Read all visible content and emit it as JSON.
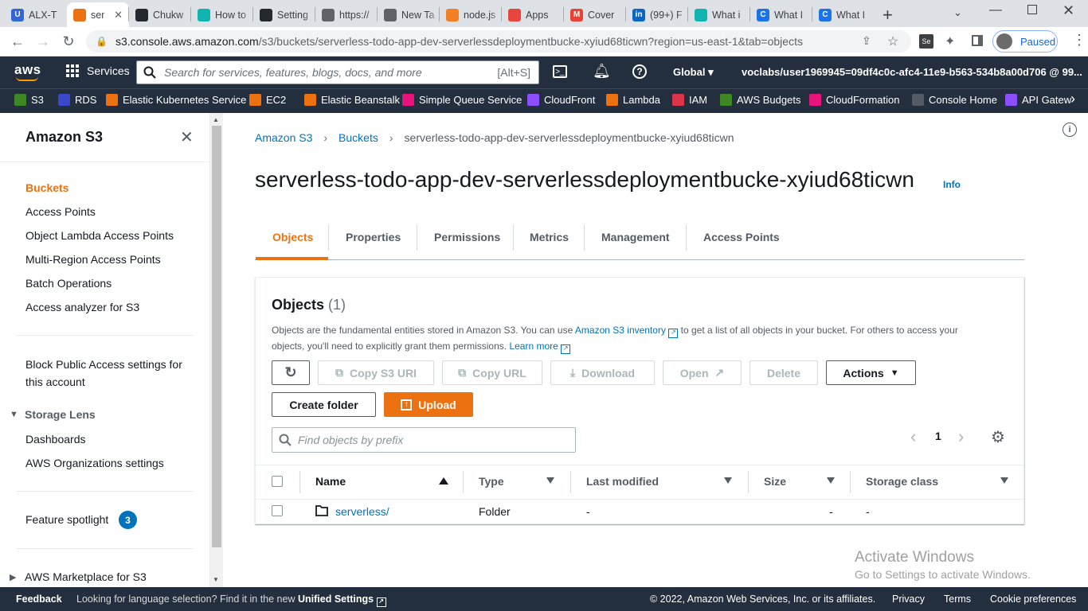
{
  "browser": {
    "tabs": [
      {
        "title": "ALX-T",
        "icon_color": "#3367d6",
        "icon_letter": "U"
      },
      {
        "title": "ser",
        "icon_color": "#ec7211",
        "icon_letter": ""
      },
      {
        "title": "Chukw",
        "icon_color": "#24292e",
        "icon_letter": ""
      },
      {
        "title": "How to",
        "icon_color": "#0fb5ae",
        "icon_letter": ""
      },
      {
        "title": "Setting",
        "icon_color": "#24292e",
        "icon_letter": ""
      },
      {
        "title": "https://",
        "icon_color": "#5f6368",
        "icon_letter": ""
      },
      {
        "title": "New Ta",
        "icon_color": "#5f6368",
        "icon_letter": ""
      },
      {
        "title": "node.js",
        "icon_color": "#f48024",
        "icon_letter": ""
      },
      {
        "title": "Apps",
        "icon_color": "#e8453c",
        "icon_letter": ""
      },
      {
        "title": "Cover",
        "icon_color": "#ea4335",
        "icon_letter": "M"
      },
      {
        "title": "(99+) F",
        "icon_color": "#0a66c2",
        "icon_letter": "in"
      },
      {
        "title": "What i",
        "icon_color": "#0fb5ae",
        "icon_letter": ""
      },
      {
        "title": "What I",
        "icon_color": "#1a73e8",
        "icon_letter": "C"
      },
      {
        "title": "What I",
        "icon_color": "#1a73e8",
        "icon_letter": "C"
      }
    ],
    "url_host": "s3.console.aws.amazon.com",
    "url_path": "/s3/buckets/serverless-todo-app-dev-serverlessdeploymentbucke-xyiud68ticwn?region=us-east-1&tab=objects",
    "profile_status": "Paused"
  },
  "aws_nav": {
    "logo": "aws",
    "services_label": "Services",
    "search_placeholder": "Search for services, features, blogs, docs, and more",
    "search_shortcut": "[Alt+S]",
    "region": "Global",
    "account": "voclabs/user1969945=09df4c0c-afc4-11e9-b563-534b8a00d706 @ 99..."
  },
  "favorites": [
    {
      "label": "S3",
      "color": "#3f8624"
    },
    {
      "label": "RDS",
      "color": "#3b48cc"
    },
    {
      "label": "Elastic Kubernetes Service",
      "color": "#ec7211"
    },
    {
      "label": "EC2",
      "color": "#ec7211"
    },
    {
      "label": "Elastic Beanstalk",
      "color": "#ec7211"
    },
    {
      "label": "Simple Queue Service",
      "color": "#e7157b"
    },
    {
      "label": "CloudFront",
      "color": "#8c4fff"
    },
    {
      "label": "Lambda",
      "color": "#ec7211"
    },
    {
      "label": "IAM",
      "color": "#dd344c"
    },
    {
      "label": "AWS Budgets",
      "color": "#3f8624"
    },
    {
      "label": "CloudFormation",
      "color": "#e7157b"
    },
    {
      "label": "Console Home",
      "color": "#545b64"
    },
    {
      "label": "API Gatew",
      "color": "#8c4fff"
    }
  ],
  "sidebar": {
    "title": "Amazon S3",
    "items": [
      "Buckets",
      "Access Points",
      "Object Lambda Access Points",
      "Multi-Region Access Points",
      "Batch Operations",
      "Access analyzer for S3"
    ],
    "block_public_access": "Block Public Access settings for this account",
    "storage_lens": {
      "label": "Storage Lens",
      "items": [
        "Dashboards",
        "AWS Organizations settings"
      ]
    },
    "feature_spotlight": "Feature spotlight",
    "feature_spotlight_count": "3",
    "marketplace": "AWS Marketplace for S3"
  },
  "breadcrumb": {
    "items": [
      "Amazon S3",
      "Buckets",
      "serverless-todo-app-dev-serverlessdeploymentbucke-xyiud68ticwn"
    ]
  },
  "page": {
    "title": "serverless-todo-app-dev-serverlessdeploymentbucke-xyiud68ticwn",
    "info": "Info"
  },
  "tabs": [
    "Objects",
    "Properties",
    "Permissions",
    "Metrics",
    "Management",
    "Access Points"
  ],
  "objects_panel": {
    "title": "Objects",
    "count": "(1)",
    "desc_1": "Objects are the fundamental entities stored in Amazon S3. You can use",
    "inventory_link": "Amazon S3 inventory",
    "desc_2": "to get a list of all objects in your bucket. For others to access your",
    "desc_3": "objects, you'll need to explicitly grant them permissions.",
    "learn_more": "Learn more",
    "buttons": {
      "copy_uri": "Copy S3 URI",
      "copy_url": "Copy URL",
      "download": "Download",
      "open": "Open",
      "delete": "Delete",
      "actions": "Actions",
      "create_folder": "Create folder",
      "upload": "Upload"
    },
    "search_placeholder": "Find objects by prefix",
    "page_number": "1",
    "columns": [
      "Name",
      "Type",
      "Last modified",
      "Size",
      "Storage class"
    ],
    "rows": [
      {
        "name": "serverless/",
        "type": "Folder",
        "last_modified": "-",
        "size": "-",
        "storage_class": "-"
      }
    ]
  },
  "watermark": {
    "line1": "Activate Windows",
    "line2": "Go to Settings to activate Windows."
  },
  "footer": {
    "feedback": "Feedback",
    "lang_text": "Looking for language selection? Find it in the new",
    "unified_settings": "Unified Settings",
    "copyright": "© 2022, Amazon Web Services, Inc. or its affiliates.",
    "privacy": "Privacy",
    "terms": "Terms",
    "cookies": "Cookie preferences"
  }
}
